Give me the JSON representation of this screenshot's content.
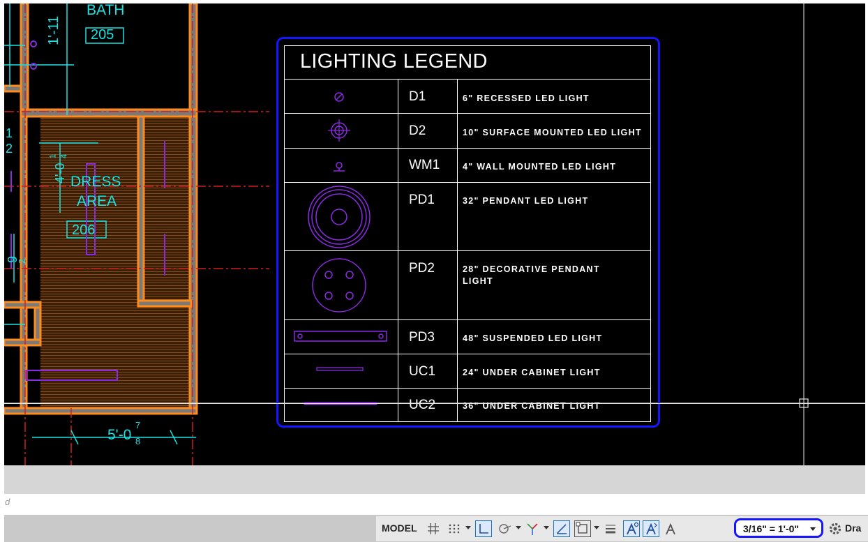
{
  "drawing": {
    "rooms": [
      {
        "name": "BATH",
        "number": "205"
      },
      {
        "name_line1": "DRESS",
        "name_line2": "AREA",
        "number": "206"
      }
    ],
    "dimensions": {
      "dim_top_vertical": "1'-11",
      "dim_left_a": "1",
      "dim_left_b": "2",
      "dim_dress": "4'-0",
      "dim_dress_frac_num": "1",
      "dim_dress_frac_den": "4",
      "dim_left_lower": "9",
      "dim_left_lower_frac": "2",
      "dim_bottom": "5'-0",
      "dim_bottom_frac_num": "7",
      "dim_bottom_frac_den": "8"
    },
    "colors": {
      "background": "#000000",
      "wall": "#ff8c1a",
      "dimension": "#19e3e3",
      "fixture": "#8a2be2",
      "centerline": "#d01f1f",
      "highlight": "#1515ff"
    }
  },
  "legend": {
    "title": "LIGHTING LEGEND",
    "rows": [
      {
        "symbol": "recessed-light-icon",
        "code": "D1",
        "description": "6\" RECESSED LED LIGHT"
      },
      {
        "symbol": "surface-mounted-light-icon",
        "code": "D2",
        "description": "10\" SURFACE MOUNTED LED LIGHT"
      },
      {
        "symbol": "wall-mounted-light-icon",
        "code": "WM1",
        "description": "4\" WALL MOUNTED LED LIGHT"
      },
      {
        "symbol": "pendant-light-icon",
        "code": "PD1",
        "description": "32\" PENDANT LED LIGHT"
      },
      {
        "symbol": "decorative-pendant-icon",
        "code": "PD2",
        "description": "28\" DECORATIVE PENDANT LIGHT"
      },
      {
        "symbol": "suspended-light-icon",
        "code": "PD3",
        "description": "48\" SUSPENDED LED LIGHT"
      },
      {
        "symbol": "under-cabinet-light-icon",
        "code": "UC1",
        "description": "24\" UNDER CABINET LIGHT"
      },
      {
        "symbol": "under-cabinet-light-long-icon",
        "code": "UC2",
        "description": "36\" UNDER CABINET LIGHT"
      }
    ]
  },
  "command_line": {
    "text": "d"
  },
  "status_bar": {
    "model_label": "MODEL",
    "annotation_scale": "3/16\" = 1'-0\"",
    "workspace_label": "Dra",
    "icons": [
      "grid-icon",
      "snap-icon",
      "ortho-icon",
      "polar-icon",
      "isodraft-icon",
      "osnap-icon",
      "dynamic-ucs-icon",
      "lineweight-icon",
      "annotation-visibility-icon",
      "auto-scale-icon",
      "annotation-scale-icon",
      "settings-gear-icon"
    ]
  }
}
